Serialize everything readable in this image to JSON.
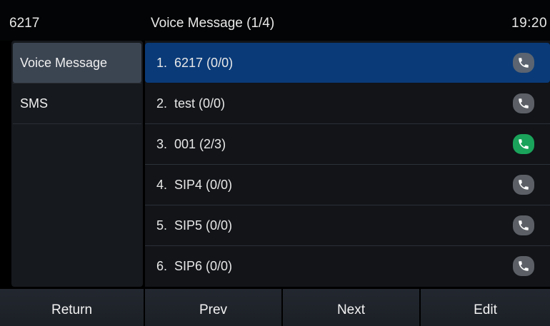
{
  "titlebar": {
    "account": "6217",
    "title": "Voice Message (1/4)",
    "clock": "19:20"
  },
  "sidebar": {
    "items": [
      {
        "label": "Voice Message",
        "active": true
      },
      {
        "label": "SMS",
        "active": false
      }
    ]
  },
  "list": {
    "rows": [
      {
        "label": "1.  6217 (0/0)",
        "selected": true,
        "icon": "phone-icon",
        "icon_color": "#5b6470"
      },
      {
        "label": "2.  test (0/0)",
        "selected": false,
        "icon": "phone-icon",
        "icon_color": "#5c6066"
      },
      {
        "label": "3.  001 (2/3)",
        "selected": false,
        "icon": "phone-icon",
        "icon_color": "#1aa35a"
      },
      {
        "label": "4.  SIP4 (0/0)",
        "selected": false,
        "icon": "phone-icon",
        "icon_color": "#5c6066"
      },
      {
        "label": "5.  SIP5 (0/0)",
        "selected": false,
        "icon": "phone-icon",
        "icon_color": "#5c6066"
      },
      {
        "label": "6.  SIP6 (0/0)",
        "selected": false,
        "icon": "phone-icon",
        "icon_color": "#5c6066"
      }
    ]
  },
  "softkeys": {
    "return_label": "Return",
    "prev_label": "Prev",
    "next_label": "Next",
    "edit_label": "Edit"
  },
  "colors": {
    "selection": "#0a3a78",
    "active_sidebar": "#3b4552",
    "new_message_green": "#1aa35a"
  }
}
